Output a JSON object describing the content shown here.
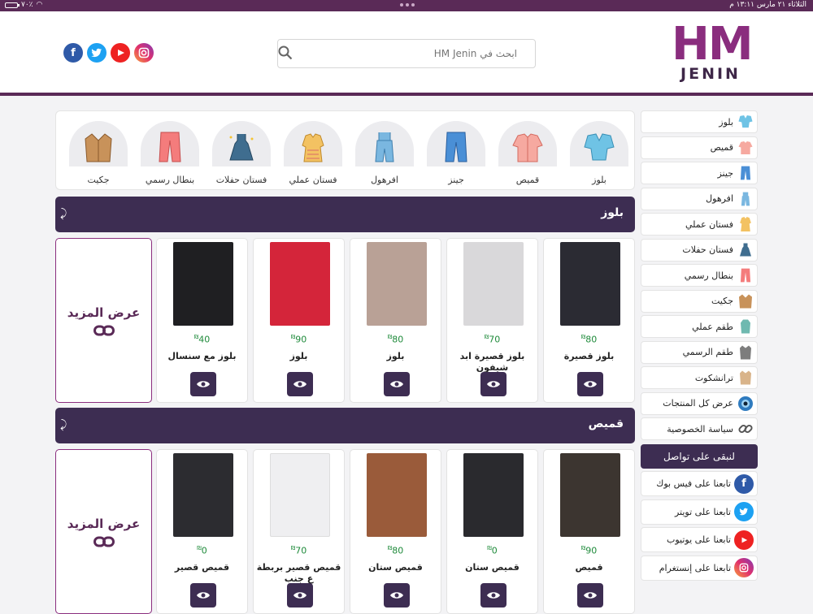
{
  "status": {
    "time": "١٣:١١ م",
    "date": "الثلاثاء ٢١ مارس",
    "battery": "٧٠٪"
  },
  "header": {
    "logo_top": "HM",
    "logo_bottom": "JENIN",
    "search_placeholder": "ابحث في HM Jenin",
    "socials": [
      "facebook-icon",
      "twitter-icon",
      "youtube-icon",
      "instagram-icon"
    ]
  },
  "categories": [
    {
      "label": "بلوز",
      "icon": "blouse-icon"
    },
    {
      "label": "قميص",
      "icon": "shirt-icon"
    },
    {
      "label": "جينز",
      "icon": "jeans-icon"
    },
    {
      "label": "افرهول",
      "icon": "overalls-icon"
    },
    {
      "label": "فستان عملي",
      "icon": "casual-dress-icon"
    },
    {
      "label": "فستان حفلات",
      "icon": "party-dress-icon"
    },
    {
      "label": "بنطال رسمي",
      "icon": "trousers-icon"
    },
    {
      "label": "جكيت",
      "icon": "jacket-icon"
    }
  ],
  "sidebar": {
    "items": [
      {
        "label": "بلوز"
      },
      {
        "label": "قميص"
      },
      {
        "label": "جينز"
      },
      {
        "label": "افرهول"
      },
      {
        "label": "فستان عملي"
      },
      {
        "label": "فستان حفلات"
      },
      {
        "label": "بنطال رسمي"
      },
      {
        "label": "جكيت"
      },
      {
        "label": "طقم عملي"
      },
      {
        "label": "طقم الرسمي"
      },
      {
        "label": "ترانشكوت"
      },
      {
        "label": "عرض كل المنتجات"
      },
      {
        "label": "سياسة الخصوصية"
      }
    ],
    "contact_header": "لنبقى على تواصل",
    "contact": [
      {
        "label": "تابعنا على فيس بوك"
      },
      {
        "label": "تابعنا على تويتر"
      },
      {
        "label": "تابعنا على يوتيوب"
      },
      {
        "label": "تابعنا على إنستغرام"
      }
    ]
  },
  "sections": [
    {
      "title": "بلوز",
      "more_label": "عرض المزيد",
      "products": [
        {
          "name": "بلوز قصيرة",
          "price": "80",
          "color": "#2b2b33"
        },
        {
          "name": "بلوز قصيرة ابد شيفون",
          "price": "70",
          "color": "#d9d8da"
        },
        {
          "name": "بلوز",
          "price": "80",
          "color": "#b9a196"
        },
        {
          "name": "بلوز",
          "price": "90",
          "color": "#d4253a"
        },
        {
          "name": "بلوز مع سنسال",
          "price": "40",
          "color": "#1f1f22"
        }
      ]
    },
    {
      "title": "قميص",
      "more_label": "عرض المزيد",
      "products": [
        {
          "name": "قميص",
          "price": "90",
          "color": "#3c3530"
        },
        {
          "name": "قميص ستان",
          "price": "0",
          "color": "#2a2a2e"
        },
        {
          "name": "قميص ستان",
          "price": "80",
          "color": "#9a5b3a"
        },
        {
          "name": "قميص قصير بربطة ع جنب",
          "price": "70",
          "color": "#efeff1"
        },
        {
          "name": "قميص قصير",
          "price": "0",
          "color": "#2c2c30"
        }
      ]
    }
  ],
  "currency": "₪",
  "colors": {
    "brand": "#8a2d7e",
    "dark": "#3d2d52",
    "price": "#1e8a3a"
  }
}
